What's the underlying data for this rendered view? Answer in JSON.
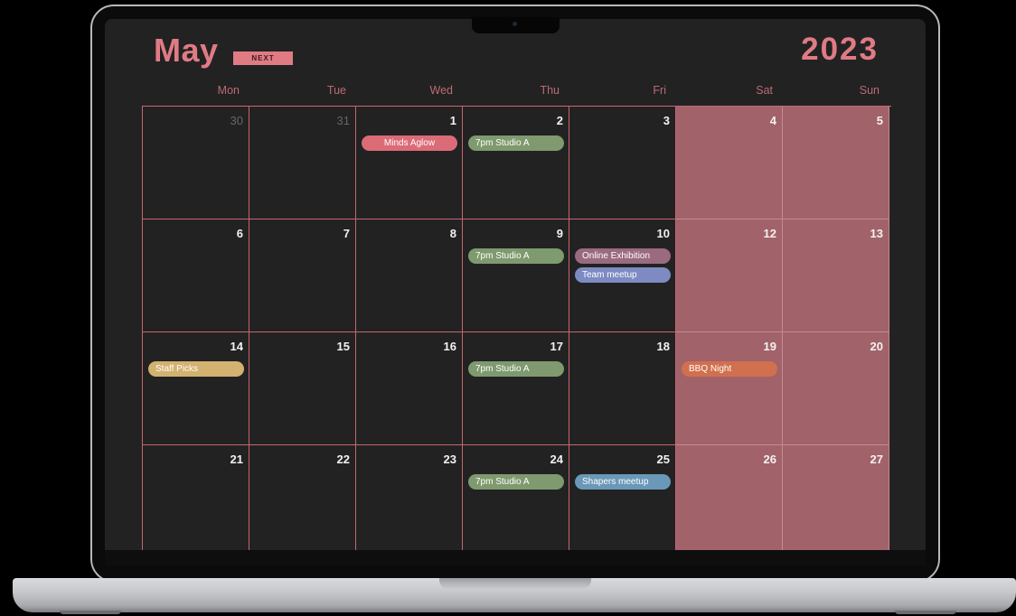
{
  "calendar": {
    "month": "May",
    "year": "2023",
    "next_label": "NEXT",
    "weekdays": [
      "Mon",
      "Tue",
      "Wed",
      "Thu",
      "Fri",
      "Sat",
      "Sun"
    ]
  },
  "colors": {
    "accent": "#e07b84",
    "weekend_bg": "#a2626a",
    "screen_bg": "#222223",
    "grid_line": "#c86570"
  },
  "weeks": [
    [
      {
        "day": "30",
        "other": true
      },
      {
        "day": "31",
        "other": true
      },
      {
        "day": "1",
        "events": [
          {
            "label": "Minds Aglow",
            "color": "#dc6b78",
            "center": true
          }
        ]
      },
      {
        "day": "2",
        "events": [
          {
            "label": "7pm Studio A",
            "color": "#7e9a6e"
          }
        ]
      },
      {
        "day": "3"
      },
      {
        "day": "4",
        "weekend": true
      },
      {
        "day": "5",
        "weekend": true
      }
    ],
    [
      {
        "day": "6"
      },
      {
        "day": "7"
      },
      {
        "day": "8"
      },
      {
        "day": "9",
        "events": [
          {
            "label": "7pm Studio A",
            "color": "#7e9a6e"
          }
        ]
      },
      {
        "day": "10",
        "events": [
          {
            "label": "Online Exhibition",
            "color": "#9a6a7e"
          },
          {
            "label": "Team meetup",
            "color": "#7d8bc2"
          }
        ]
      },
      {
        "day": "12",
        "weekend": true
      },
      {
        "day": "13",
        "weekend": true
      }
    ],
    [
      {
        "day": "14",
        "events": [
          {
            "label": "Staff Picks",
            "color": "#d3b170"
          }
        ]
      },
      {
        "day": "15"
      },
      {
        "day": "16"
      },
      {
        "day": "17",
        "events": [
          {
            "label": "7pm Studio A",
            "color": "#7e9a6e"
          }
        ]
      },
      {
        "day": "18"
      },
      {
        "day": "19",
        "weekend": true,
        "events": [
          {
            "label": "BBQ Night",
            "color": "#d0704e"
          }
        ]
      },
      {
        "day": "20",
        "weekend": true
      }
    ],
    [
      {
        "day": "21"
      },
      {
        "day": "22"
      },
      {
        "day": "23"
      },
      {
        "day": "24",
        "events": [
          {
            "label": "7pm Studio A",
            "color": "#7e9a6e"
          }
        ]
      },
      {
        "day": "25",
        "events": [
          {
            "label": "Shapers meetup",
            "color": "#6a98b8"
          }
        ]
      },
      {
        "day": "26",
        "weekend": true
      },
      {
        "day": "27",
        "weekend": true
      }
    ]
  ]
}
